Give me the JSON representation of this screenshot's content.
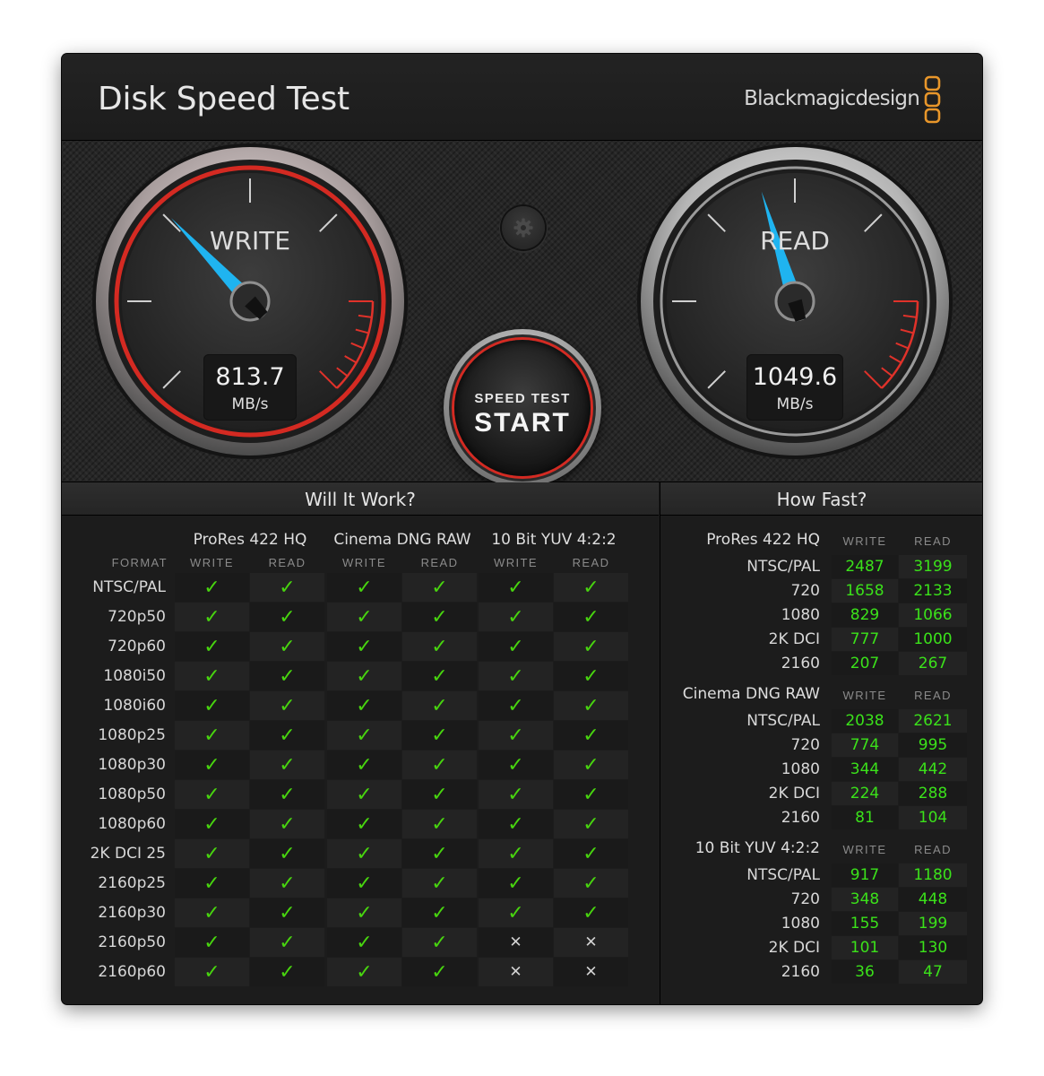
{
  "window": {
    "close_label": "✕"
  },
  "header": {
    "title": "Disk Speed Test",
    "brand": "Blackmagicdesign"
  },
  "gauges": {
    "write": {
      "label": "WRITE",
      "value": "813.7",
      "unit": "MB/s"
    },
    "read": {
      "label": "READ",
      "value": "1049.6",
      "unit": "MB/s"
    }
  },
  "start_button": {
    "line1": "SPEED TEST",
    "line2": "START"
  },
  "settings": {
    "icon": "gear-icon"
  },
  "colors": {
    "accent_red": "#d42a22",
    "needle_blue": "#1fb4f0",
    "check_green": "#48d40f",
    "value_green": "#3be21a",
    "logo_orange": "#e8962a"
  },
  "will_it_work": {
    "title": "Will It Work?",
    "format_header": "FORMAT",
    "groups": [
      {
        "name": "ProRes 422 HQ",
        "cols": [
          "WRITE",
          "READ"
        ]
      },
      {
        "name": "Cinema DNG RAW",
        "cols": [
          "WRITE",
          "READ"
        ]
      },
      {
        "name": "10 Bit YUV 4:2:2",
        "cols": [
          "WRITE",
          "READ"
        ]
      }
    ],
    "rows": [
      {
        "format": "NTSC/PAL",
        "results": [
          1,
          1,
          1,
          1,
          1,
          1
        ]
      },
      {
        "format": "720p50",
        "results": [
          1,
          1,
          1,
          1,
          1,
          1
        ]
      },
      {
        "format": "720p60",
        "results": [
          1,
          1,
          1,
          1,
          1,
          1
        ]
      },
      {
        "format": "1080i50",
        "results": [
          1,
          1,
          1,
          1,
          1,
          1
        ]
      },
      {
        "format": "1080i60",
        "results": [
          1,
          1,
          1,
          1,
          1,
          1
        ]
      },
      {
        "format": "1080p25",
        "results": [
          1,
          1,
          1,
          1,
          1,
          1
        ]
      },
      {
        "format": "1080p30",
        "results": [
          1,
          1,
          1,
          1,
          1,
          1
        ]
      },
      {
        "format": "1080p50",
        "results": [
          1,
          1,
          1,
          1,
          1,
          1
        ]
      },
      {
        "format": "1080p60",
        "results": [
          1,
          1,
          1,
          1,
          1,
          1
        ]
      },
      {
        "format": "2K DCI 25",
        "results": [
          1,
          1,
          1,
          1,
          1,
          1
        ]
      },
      {
        "format": "2160p25",
        "results": [
          1,
          1,
          1,
          1,
          1,
          1
        ]
      },
      {
        "format": "2160p30",
        "results": [
          1,
          1,
          1,
          1,
          1,
          1
        ]
      },
      {
        "format": "2160p50",
        "results": [
          1,
          1,
          1,
          1,
          0,
          0
        ]
      },
      {
        "format": "2160p60",
        "results": [
          1,
          1,
          1,
          1,
          0,
          0
        ]
      }
    ]
  },
  "how_fast": {
    "title": "How Fast?",
    "col_write": "WRITE",
    "col_read": "READ",
    "groups": [
      {
        "name": "ProRes 422 HQ",
        "rows": [
          {
            "res": "NTSC/PAL",
            "write": "2487",
            "read": "3199"
          },
          {
            "res": "720",
            "write": "1658",
            "read": "2133"
          },
          {
            "res": "1080",
            "write": "829",
            "read": "1066"
          },
          {
            "res": "2K DCI",
            "write": "777",
            "read": "1000"
          },
          {
            "res": "2160",
            "write": "207",
            "read": "267"
          }
        ]
      },
      {
        "name": "Cinema DNG RAW",
        "rows": [
          {
            "res": "NTSC/PAL",
            "write": "2038",
            "read": "2621"
          },
          {
            "res": "720",
            "write": "774",
            "read": "995"
          },
          {
            "res": "1080",
            "write": "344",
            "read": "442"
          },
          {
            "res": "2K DCI",
            "write": "224",
            "read": "288"
          },
          {
            "res": "2160",
            "write": "81",
            "read": "104"
          }
        ]
      },
      {
        "name": "10 Bit YUV 4:2:2",
        "rows": [
          {
            "res": "NTSC/PAL",
            "write": "917",
            "read": "1180"
          },
          {
            "res": "720",
            "write": "348",
            "read": "448"
          },
          {
            "res": "1080",
            "write": "155",
            "read": "199"
          },
          {
            "res": "2K DCI",
            "write": "101",
            "read": "130"
          },
          {
            "res": "2160",
            "write": "36",
            "read": "47"
          }
        ]
      }
    ]
  }
}
